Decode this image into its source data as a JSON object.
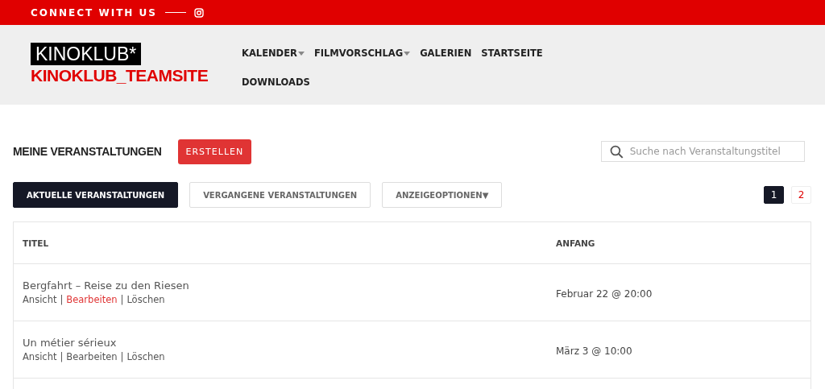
{
  "topbar": {
    "text": "CONNECT WITH US"
  },
  "logo": {
    "wordmark": "KINOKLUB*",
    "site_name": "KINOKLUB_TEAMSITE"
  },
  "nav": [
    {
      "label": "KALENDER",
      "has_dropdown": true
    },
    {
      "label": "FILMVORSCHLAG",
      "has_dropdown": true
    },
    {
      "label": "GALERIEN",
      "has_dropdown": false
    },
    {
      "label": "STARTSEITE",
      "has_dropdown": false
    },
    {
      "label": "DOWNLOADS",
      "has_dropdown": false
    }
  ],
  "heading": "MEINE VERANSTALTUNGEN",
  "create_button": "ERSTELLEN",
  "search": {
    "placeholder": "Suche nach Veranstaltungstitel"
  },
  "tabs": [
    {
      "label": "AKTUELLE VERANSTALTUNGEN",
      "selected": true
    },
    {
      "label": "VERGANGENE VERANSTALTUNGEN",
      "selected": false
    }
  ],
  "options_button": "ANZEIGEOPTIONEN▼",
  "pages": [
    {
      "label": "1",
      "selected": true
    },
    {
      "label": "2",
      "selected": false
    }
  ],
  "table": {
    "columns": [
      "TITEL",
      "ANFANG"
    ],
    "separator": "|",
    "rows": [
      {
        "title": "Bergfahrt – Reise zu den Riesen",
        "start": "Februar 22 @ 20:00",
        "actions": [
          {
            "label": "Ansicht",
            "highlighted": false
          },
          {
            "label": "Bearbeiten",
            "highlighted": true
          },
          {
            "label": "Löschen",
            "highlighted": false
          }
        ]
      },
      {
        "title": "Un métier sérieux",
        "start": "März 3 @ 10:00",
        "actions": [
          {
            "label": "Ansicht",
            "highlighted": false
          },
          {
            "label": "Bearbeiten",
            "highlighted": false
          },
          {
            "label": "Löschen",
            "highlighted": false
          }
        ]
      }
    ]
  }
}
